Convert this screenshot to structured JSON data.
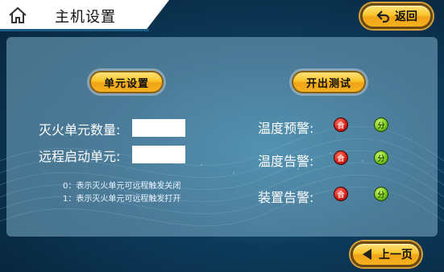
{
  "header": {
    "title": "主机设置",
    "back_label": "返回"
  },
  "left": {
    "section_button": "单元设置",
    "fields": [
      {
        "label": "灭火单元数量:",
        "value": ""
      },
      {
        "label": "远程启动单元:",
        "value": ""
      }
    ],
    "notes": [
      "0：表示灭火单元可远程触发关闭",
      "1：表示灭火单元可远程触发打开"
    ]
  },
  "right": {
    "section_button": "开出测试",
    "rows": [
      {
        "label": "温度预警:",
        "on": "合",
        "off": "分"
      },
      {
        "label": "温度告警:",
        "on": "合",
        "off": "分"
      },
      {
        "label": "装置告警:",
        "on": "合",
        "off": "分"
      }
    ]
  },
  "footer": {
    "prev_label": "上一页"
  },
  "icons": {
    "home": "home-icon",
    "back": "back-arrow-icon",
    "prev": "left-triangle-icon"
  },
  "colors": {
    "button_gold": "#f9c429",
    "indicator_red": "#d9221a",
    "indicator_green": "#77c71f",
    "panel": "#7dafc8"
  }
}
